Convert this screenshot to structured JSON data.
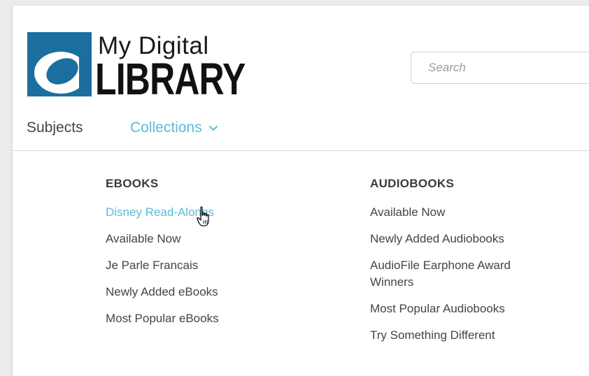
{
  "header": {
    "logo_line1": "My Digital",
    "logo_line2": "LIBRARY",
    "search_placeholder": "Search"
  },
  "nav": {
    "subjects": "Subjects",
    "collections": "Collections",
    "collections_icon": "chevron-down-icon"
  },
  "colors": {
    "accent": "#5bbbd8",
    "logo_blue": "#1a6f9e",
    "text": "#444444"
  },
  "menu": {
    "ebooks": {
      "heading": "EBOOKS",
      "items": [
        "Disney Read-Alongs",
        "Available Now",
        "Je Parle Francais",
        "Newly Added eBooks",
        "Most Popular eBooks"
      ]
    },
    "audiobooks": {
      "heading": "AUDIOBOOKS",
      "items": [
        "Available Now",
        "Newly Added Audiobooks",
        "AudioFile Earphone Award Winners",
        "Most Popular Audiobooks",
        "Try Something Different"
      ]
    }
  }
}
